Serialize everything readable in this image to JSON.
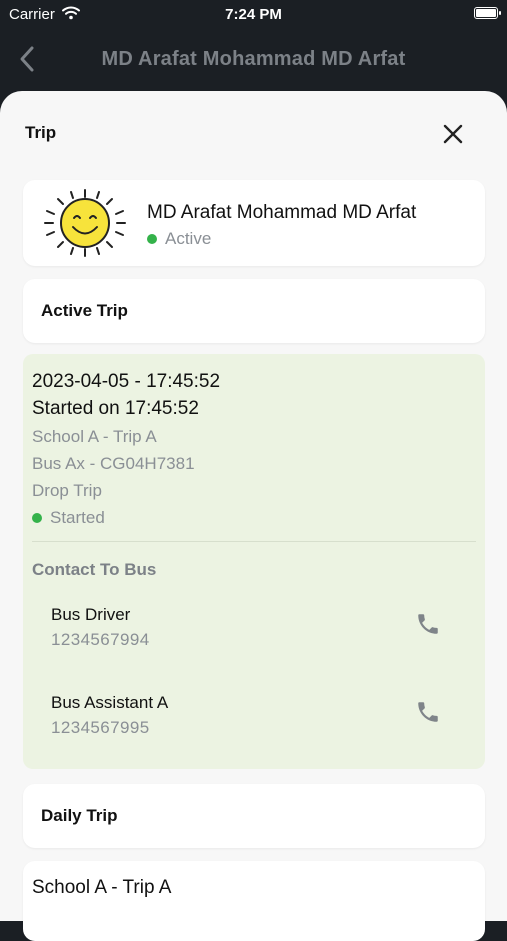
{
  "status_bar": {
    "carrier": "Carrier",
    "time": "7:24 PM"
  },
  "nav": {
    "title": "MD Arafat Mohammad  MD Arfat"
  },
  "sheet": {
    "title": "Trip"
  },
  "profile": {
    "name": "MD Arafat Mohammad  MD Arfat",
    "status": "Active",
    "status_color": "#34b24a"
  },
  "active_trip": {
    "section_label": "Active Trip",
    "datetime": "2023-04-05 - 17:45:52",
    "started_on": "Started on 17:45:52",
    "school_trip": "School A - Trip A",
    "bus": "Bus Ax - CG04H7381",
    "trip_type": "Drop Trip",
    "status": "Started",
    "contact_title": "Contact To Bus",
    "contacts": [
      {
        "role": "Bus  Driver",
        "phone": "1234567994"
      },
      {
        "role": "Bus Assistant A",
        "phone": "1234567995"
      }
    ],
    "background_color": "#ecf3e2"
  },
  "daily_trip": {
    "section_label": "Daily Trip",
    "items": [
      {
        "label": "School A - Trip A"
      }
    ]
  },
  "icons": {
    "back": "chevron-left-icon",
    "close": "close-icon",
    "phone": "phone-icon",
    "wifi": "wifi-icon",
    "battery": "battery-icon",
    "avatar": "sun-avatar"
  }
}
